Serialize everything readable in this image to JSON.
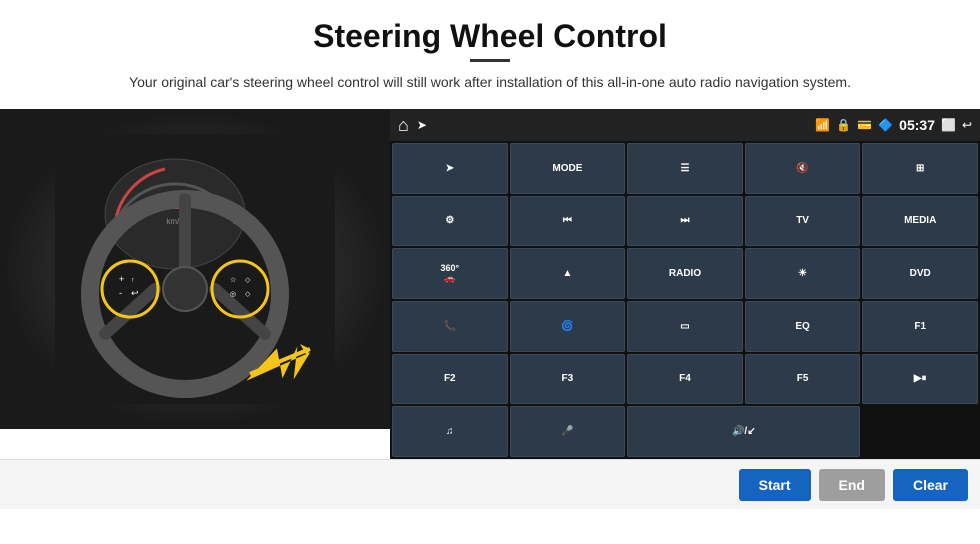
{
  "page": {
    "title": "Steering Wheel Control",
    "subtitle": "Your original car's steering wheel control will still work after installation of this all-in-one auto radio navigation system.",
    "divider": true
  },
  "header": {
    "time": "05:37",
    "icons": [
      "home",
      "wifi",
      "lock",
      "sd",
      "bluetooth",
      "cast",
      "back"
    ]
  },
  "panel": {
    "rows": [
      [
        {
          "label": "➤",
          "type": "icon"
        },
        {
          "label": "MODE",
          "type": "text"
        },
        {
          "label": "≡",
          "type": "icon"
        },
        {
          "label": "🔇",
          "type": "icon"
        },
        {
          "label": "⊞",
          "type": "icon"
        }
      ],
      [
        {
          "label": "⚙",
          "type": "icon"
        },
        {
          "label": "⏮",
          "type": "icon"
        },
        {
          "label": "⏭",
          "type": "icon"
        },
        {
          "label": "TV",
          "type": "text"
        },
        {
          "label": "MEDIA",
          "type": "text"
        }
      ],
      [
        {
          "label": "360°",
          "type": "text"
        },
        {
          "label": "▲",
          "type": "icon"
        },
        {
          "label": "RADIO",
          "type": "text"
        },
        {
          "label": "☀",
          "type": "icon"
        },
        {
          "label": "DVD",
          "type": "text"
        }
      ],
      [
        {
          "label": "📞",
          "type": "icon"
        },
        {
          "label": "🌀",
          "type": "icon"
        },
        {
          "label": "▭",
          "type": "icon"
        },
        {
          "label": "EQ",
          "type": "text"
        },
        {
          "label": "F1",
          "type": "text"
        }
      ],
      [
        {
          "label": "F2",
          "type": "text"
        },
        {
          "label": "F3",
          "type": "text"
        },
        {
          "label": "F4",
          "type": "text"
        },
        {
          "label": "F5",
          "type": "text"
        },
        {
          "label": "▶⏸",
          "type": "icon"
        }
      ],
      [
        {
          "label": "♪",
          "type": "icon"
        },
        {
          "label": "🎤",
          "type": "icon"
        },
        {
          "label": "🔊/↙",
          "type": "icon",
          "span": 2
        },
        {
          "label": "",
          "type": "empty",
          "hidden": true
        }
      ]
    ]
  },
  "buttons": {
    "start": "Start",
    "end": "End",
    "clear": "Clear"
  }
}
